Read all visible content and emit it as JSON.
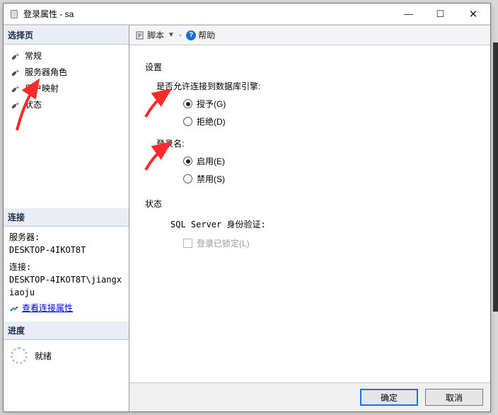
{
  "title": "登录属性 - sa",
  "sidebar": {
    "selectPage": "选择页",
    "items": [
      "常规",
      "服务器角色",
      "用户映射",
      "状态"
    ],
    "connection": {
      "header": "连接",
      "serverLabel": "服务器:",
      "serverValue": "DESKTOP-4IKOT8T",
      "connLabel": "连接:",
      "connValue": "DESKTOP-4IKOT8T\\jiangxiaoju",
      "viewProps": "查看连接属性"
    },
    "progress": {
      "header": "进度",
      "status": "就绪"
    }
  },
  "toolbar": {
    "script": "脚本",
    "help": "帮助"
  },
  "content": {
    "settings": "设置",
    "permissionLabel": "是否允许连接到数据库引擎:",
    "grant": "授予(G)",
    "deny": "拒绝(D)",
    "loginLabel": "登录名:",
    "enable": "启用(E)",
    "disable": "禁用(S)",
    "statusLabel": "状态",
    "sqlAuth": "SQL Server 身份验证:",
    "locked": "登录已锁定(L)"
  },
  "footer": {
    "ok": "确定",
    "cancel": "取消"
  }
}
